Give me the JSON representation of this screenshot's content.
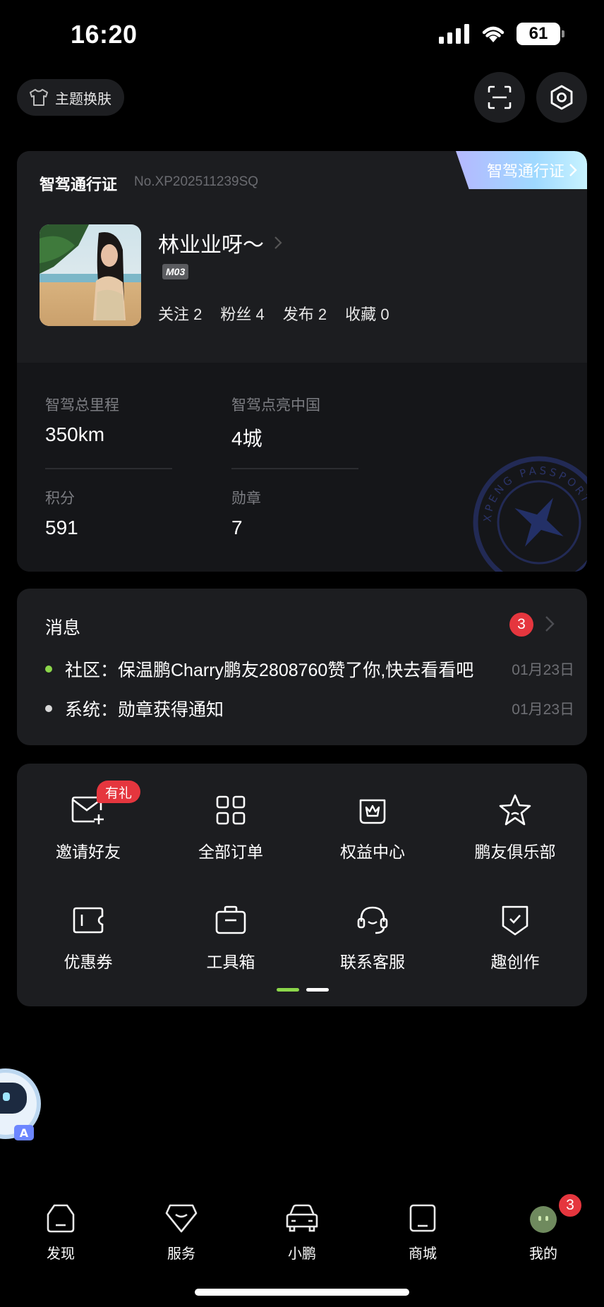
{
  "status_bar": {
    "time": "16:20",
    "battery": "61"
  },
  "top_bar": {
    "theme_label": "主题换肤"
  },
  "passport": {
    "title": "智驾通行证",
    "number": "No.XP202511239SQ",
    "tag_label": "智驾通行证",
    "username": "林业业呀～",
    "model_badge": "M03",
    "social": [
      {
        "label": "关注",
        "value": "2"
      },
      {
        "label": "粉丝",
        "value": "4"
      },
      {
        "label": "发布",
        "value": "2"
      },
      {
        "label": "收藏",
        "value": "0"
      }
    ],
    "stats": [
      {
        "label": "智驾总里程",
        "value": "350km"
      },
      {
        "label": "智驾点亮中国",
        "value": "4城"
      },
      {
        "label": "积分",
        "value": "591"
      },
      {
        "label": "勋章",
        "value": "7"
      }
    ],
    "stamp_text": "XPENG PASSPORT"
  },
  "messages": {
    "title": "消息",
    "unread_count": "3",
    "items": [
      {
        "text": "社区：保温鹏Charry鹏友2808760赞了你,快去看看吧",
        "date": "01月23日",
        "dot_color": "#8bd64a"
      },
      {
        "text": "系统：勋章获得通知",
        "date": "01月23日",
        "dot_color": "#d8d8d8"
      }
    ]
  },
  "menu": {
    "gift_badge": "有礼",
    "items": [
      {
        "label": "邀请好友",
        "icon": "mail-plus-icon"
      },
      {
        "label": "全部订单",
        "icon": "grid-icon"
      },
      {
        "label": "权益中心",
        "icon": "crown-box-icon"
      },
      {
        "label": "鹏友俱乐部",
        "icon": "star-icon"
      },
      {
        "label": "优惠券",
        "icon": "coupon-icon"
      },
      {
        "label": "工具箱",
        "icon": "toolbox-icon"
      },
      {
        "label": "联系客服",
        "icon": "headset-icon"
      },
      {
        "label": "趣创作",
        "icon": "shield-check-icon"
      }
    ],
    "pager_active_color": "#8bd64a"
  },
  "tabbar": {
    "items": [
      {
        "label": "发现",
        "icon": "discover-icon"
      },
      {
        "label": "服务",
        "icon": "service-icon"
      },
      {
        "label": "小鹏",
        "icon": "car-icon"
      },
      {
        "label": "商城",
        "icon": "shop-icon"
      },
      {
        "label": "我的",
        "icon": "profile-icon"
      }
    ],
    "profile_badge": "3"
  },
  "colors": {
    "accent_green": "#8bd64a",
    "badge_red": "#e5363e",
    "card_bg": "#1c1d20"
  }
}
